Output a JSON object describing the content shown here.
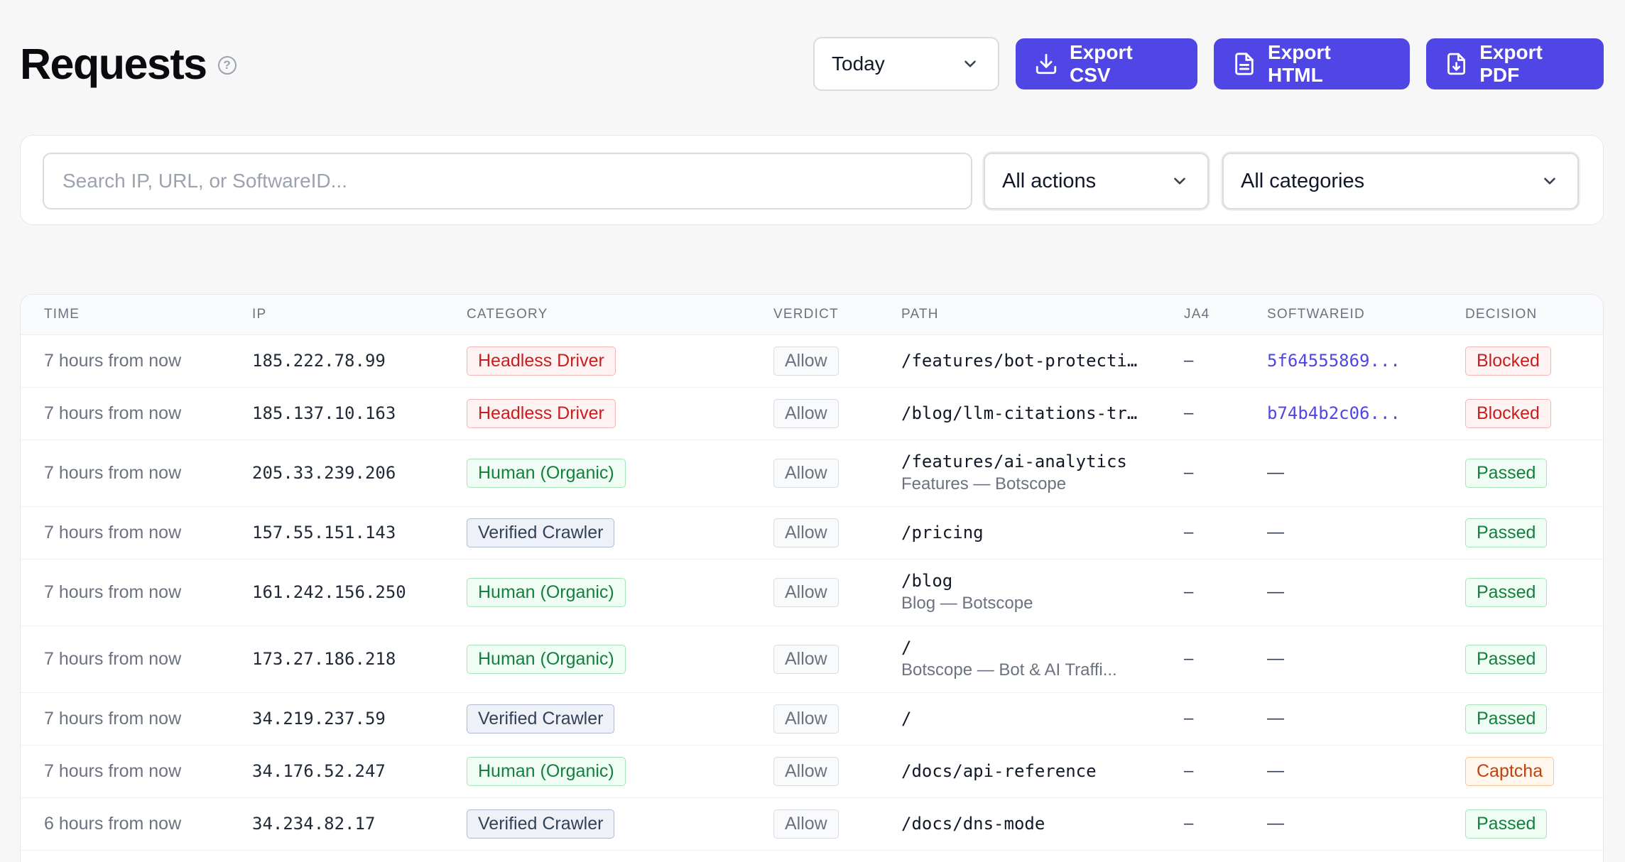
{
  "header": {
    "title": "Requests",
    "date_filter": "Today",
    "export_csv": "Export CSV",
    "export_html": "Export HTML",
    "export_pdf": "Export PDF"
  },
  "filters": {
    "search_placeholder": "Search IP, URL, or SoftwareID...",
    "search_value": "",
    "actions_value": "All actions",
    "categories_value": "All categories"
  },
  "table": {
    "columns": {
      "time": "TIME",
      "ip": "IP",
      "category": "CATEGORY",
      "verdict": "VERDICT",
      "path": "PATH",
      "ja4": "JA4",
      "softwareid": "SOFTWAREID",
      "decision": "DECISION"
    },
    "rows": [
      {
        "time": "7 hours from now",
        "ip": "185.222.78.99",
        "category": "Headless Driver",
        "verdict": "Allow",
        "path": "/features/bot-protecti…",
        "path_sub": "",
        "ja4": "–",
        "softwareid": "5f64555869...",
        "decision": "Blocked"
      },
      {
        "time": "7 hours from now",
        "ip": "185.137.10.163",
        "category": "Headless Driver",
        "verdict": "Allow",
        "path": "/blog/llm-citations-tr…",
        "path_sub": "",
        "ja4": "–",
        "softwareid": "b74b4b2c06...",
        "decision": "Blocked"
      },
      {
        "time": "7 hours from now",
        "ip": "205.33.239.206",
        "category": "Human (Organic)",
        "verdict": "Allow",
        "path": "/features/ai-analytics",
        "path_sub": "Features — Botscope",
        "ja4": "–",
        "softwareid": "—",
        "decision": "Passed"
      },
      {
        "time": "7 hours from now",
        "ip": "157.55.151.143",
        "category": "Verified Crawler",
        "verdict": "Allow",
        "path": "/pricing",
        "path_sub": "",
        "ja4": "–",
        "softwareid": "—",
        "decision": "Passed"
      },
      {
        "time": "7 hours from now",
        "ip": "161.242.156.250",
        "category": "Human (Organic)",
        "verdict": "Allow",
        "path": "/blog",
        "path_sub": "Blog — Botscope",
        "ja4": "–",
        "softwareid": "—",
        "decision": "Passed"
      },
      {
        "time": "7 hours from now",
        "ip": "173.27.186.218",
        "category": "Human (Organic)",
        "verdict": "Allow",
        "path": "/",
        "path_sub": "Botscope — Bot & AI Traffi...",
        "ja4": "–",
        "softwareid": "—",
        "decision": "Passed"
      },
      {
        "time": "7 hours from now",
        "ip": "34.219.237.59",
        "category": "Verified Crawler",
        "verdict": "Allow",
        "path": "/",
        "path_sub": "",
        "ja4": "–",
        "softwareid": "—",
        "decision": "Passed"
      },
      {
        "time": "7 hours from now",
        "ip": "34.176.52.247",
        "category": "Human (Organic)",
        "verdict": "Allow",
        "path": "/docs/api-reference",
        "path_sub": "",
        "ja4": "–",
        "softwareid": "—",
        "decision": "Captcha"
      },
      {
        "time": "6 hours from now",
        "ip": "34.234.82.17",
        "category": "Verified Crawler",
        "verdict": "Allow",
        "path": "/docs/dns-mode",
        "path_sub": "",
        "ja4": "–",
        "softwareid": "—",
        "decision": "Passed"
      }
    ]
  },
  "colors": {
    "accent": "#4f46e5",
    "blocked": "#c81e1e",
    "passed": "#15803d",
    "captcha": "#c2410c",
    "crawler": "#334155"
  },
  "icons": {
    "help": "question-circle-icon",
    "chevron": "chevron-down-icon",
    "download": "download-icon",
    "file": "file-icon",
    "file_download": "file-download-icon"
  }
}
